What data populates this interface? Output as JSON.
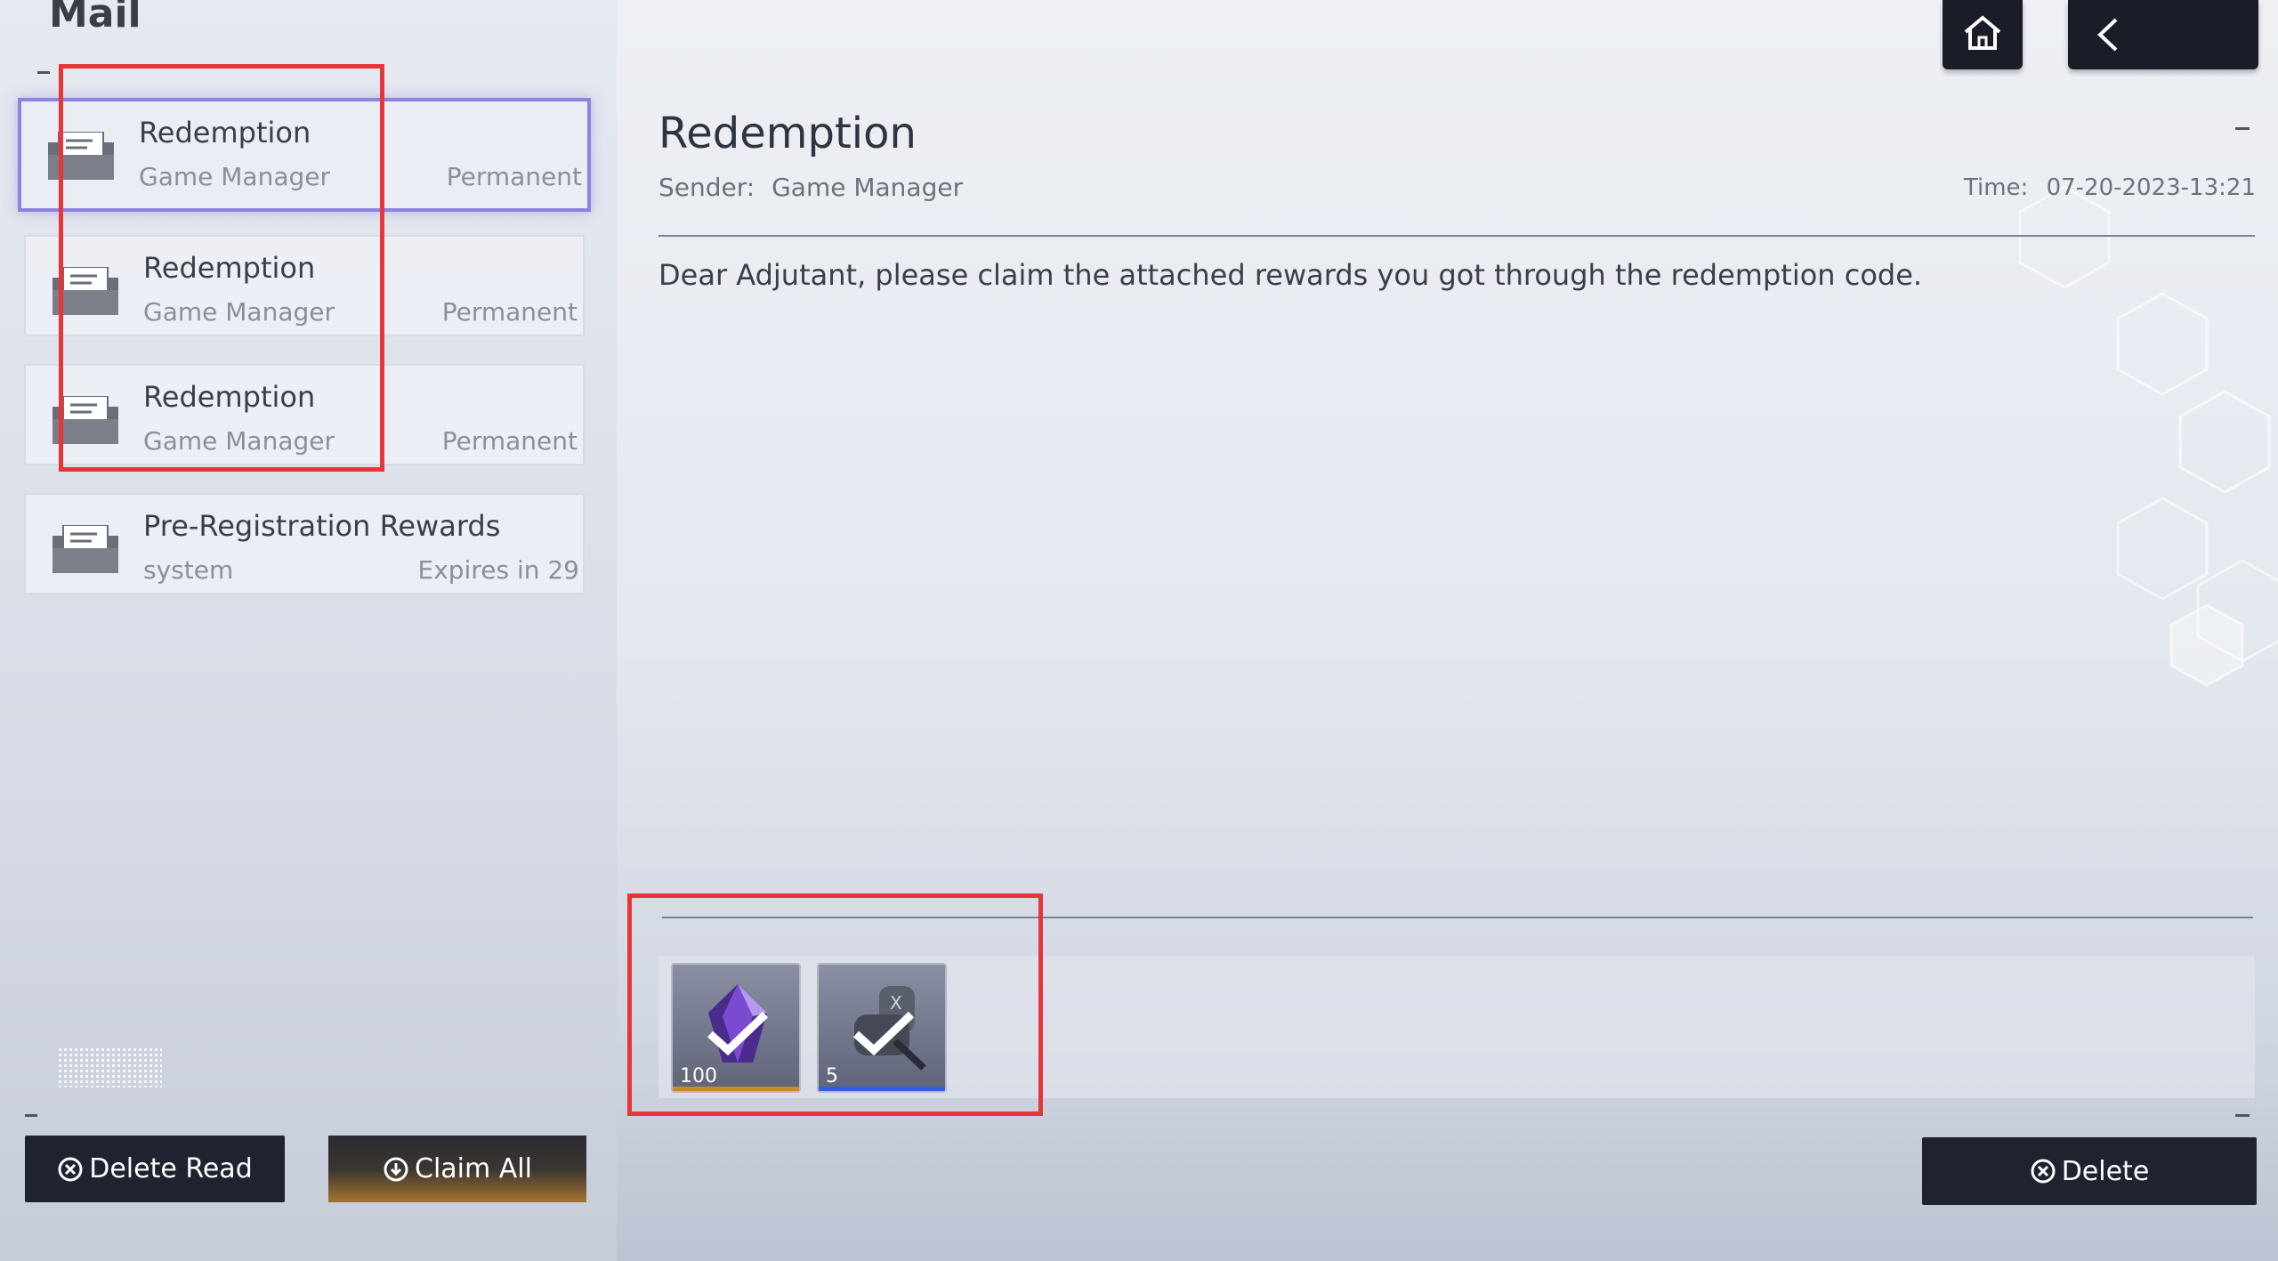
{
  "header": {
    "title": "Mail"
  },
  "mail_list": [
    {
      "subject": "Redemption",
      "sender": "Game Manager",
      "expiry": "Permanent",
      "selected": true
    },
    {
      "subject": "Redemption",
      "sender": "Game Manager",
      "expiry": "Permanent",
      "selected": false
    },
    {
      "subject": "Redemption",
      "sender": "Game Manager",
      "expiry": "Permanent",
      "selected": false
    },
    {
      "subject": "Pre-Registration Rewards",
      "sender": "system",
      "expiry": "Expires in 29",
      "selected": false
    }
  ],
  "footer": {
    "delete_read_label": "Delete Read",
    "claim_all_label": "Claim All",
    "delete_label": "Delete"
  },
  "detail": {
    "title": "Redemption",
    "sender_label": "Sender:",
    "sender_value": "Game Manager",
    "time_label": "Time:",
    "time_value": "07-20-2023-13:21",
    "body": "Dear Adjutant, please claim the attached rewards you got through the redemption code."
  },
  "attachments": [
    {
      "name": "purple-crystal",
      "quantity": "100",
      "rarity_color": "#c98a2c",
      "claimed": true
    },
    {
      "name": "mechanical-part",
      "quantity": "5",
      "rarity_color": "#2f5fd6",
      "claimed": true
    }
  ],
  "nav": {
    "home_icon": "home-icon",
    "back_icon": "back-arrow-icon"
  },
  "colors": {
    "highlight": "#e8353a",
    "selected_border": "#8a86e0"
  }
}
